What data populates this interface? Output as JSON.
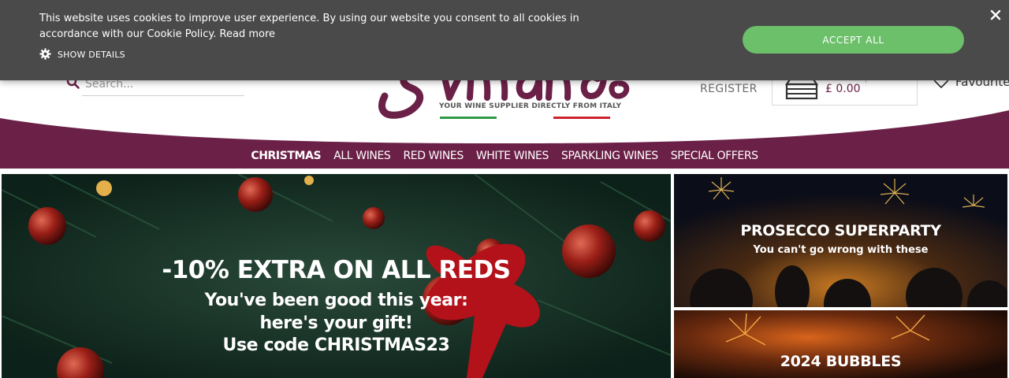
{
  "cookie": {
    "text": "This website uses cookies to improve user experience. By using our website you consent to all cookies in accordance with our Cookie Policy.",
    "read_more": "Read more",
    "show_details": "SHOW DETAILS",
    "accept_label": "ACCEPT ALL",
    "accept_color": "#6cc06a",
    "background_color": "#4a4a4a",
    "close_icon": "close-icon"
  },
  "header": {
    "search_placeholder": "Search...",
    "tagline": "YOUR WINE SUPPLIER DIRECTLY FROM ITALY",
    "register_label": "REGISTER",
    "cart_total": "£ 0.00",
    "favourites_label": "Favourites",
    "brand_color": "#6b2047"
  },
  "nav": {
    "items": [
      {
        "label": "CHRISTMAS",
        "active": true
      },
      {
        "label": "ALL WINES"
      },
      {
        "label": "RED WINES"
      },
      {
        "label": "WHITE WINES"
      },
      {
        "label": "SPARKLING WINES"
      },
      {
        "label": "SPECIAL OFFERS"
      }
    ]
  },
  "banners": {
    "main": {
      "headline": "-10% EXTRA ON ALL REDS",
      "line1": "You've been good this year:",
      "line2": "here's your gift!",
      "line3_prefix": "Use code ",
      "code": "CHRISTMAS23"
    },
    "side1": {
      "headline": "PROSECCO SUPERPARTY",
      "subline": "You can't go wrong with these"
    },
    "side2": {
      "headline": "2024 BUBBLES"
    }
  }
}
